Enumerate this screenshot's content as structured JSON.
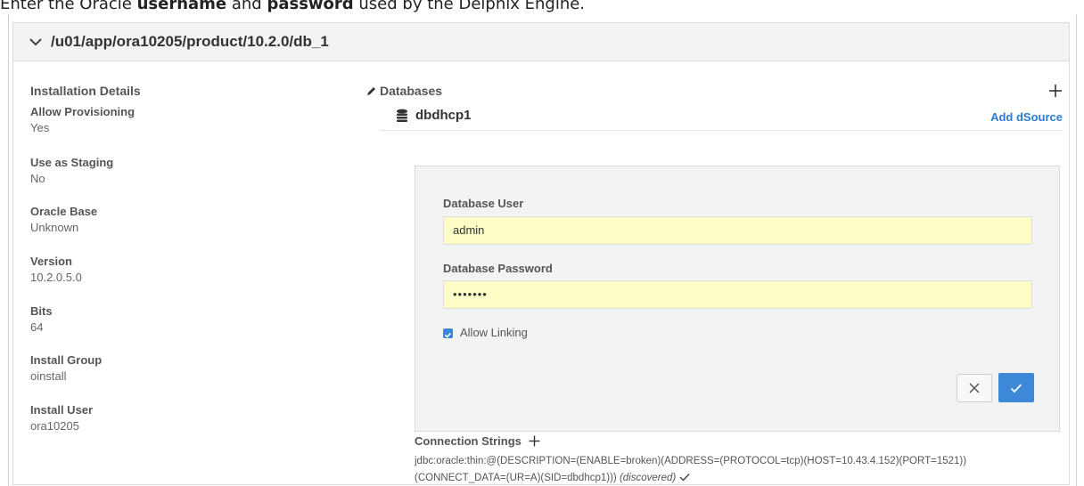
{
  "intro": {
    "part1": "Enter the Oracle ",
    "bold1": "username",
    "part2": " and ",
    "bold2": "password",
    "part3": " used by the Delphix Engine."
  },
  "panel": {
    "path": "/u01/app/ora10205/product/10.2.0/db_1"
  },
  "installation": {
    "title": "Installation Details",
    "fields": [
      {
        "label": "Allow Provisioning",
        "value": "Yes"
      },
      {
        "label": "Use as Staging",
        "value": "No"
      },
      {
        "label": "Oracle Base",
        "value": "Unknown"
      },
      {
        "label": "Version",
        "value": "10.2.0.5.0"
      },
      {
        "label": "Bits",
        "value": "64"
      },
      {
        "label": "Install Group",
        "value": "oinstall"
      },
      {
        "label": "Install User",
        "value": "ora10205"
      }
    ]
  },
  "databases": {
    "title": "Databases",
    "db_name": "dbdhcp1",
    "add_dsource": "Add dSource",
    "form": {
      "user_label": "Database User",
      "user_value": "admin",
      "password_label": "Database Password",
      "password_value": "•••••••",
      "allow_linking_label": "Allow Linking",
      "allow_linking_checked": true
    },
    "connection": {
      "title": "Connection Strings",
      "line1": "jdbc:oracle:thin:@(DESCRIPTION=(ENABLE=broken)(ADDRESS=(PROTOCOL=tcp)(HOST=10.43.4.152)(PORT=1521))",
      "line2": "(CONNECT_DATA=(UR=A)(SID=dbdhcp1)))",
      "discovered": "(discovered)"
    }
  },
  "colors": {
    "accent": "#3d89d8",
    "input_bg": "#fdfdc8",
    "header_bg": "#f3f3f3"
  }
}
